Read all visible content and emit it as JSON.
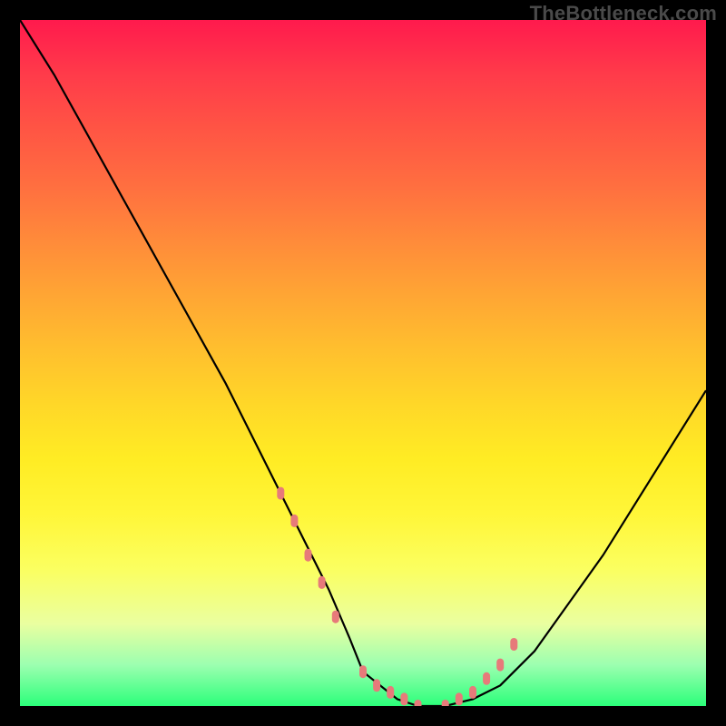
{
  "watermark": "TheBottleneck.com",
  "chart_data": {
    "type": "line",
    "title": "",
    "xlabel": "",
    "ylabel": "",
    "xlim": [
      0,
      100
    ],
    "ylim": [
      0,
      100
    ],
    "series": [
      {
        "name": "bottleneck-curve",
        "x": [
          0,
          5,
          10,
          15,
          20,
          25,
          30,
          35,
          40,
          45,
          48,
          50,
          55,
          58,
          62,
          66,
          70,
          75,
          80,
          85,
          90,
          95,
          100
        ],
        "values": [
          100,
          92,
          83,
          74,
          65,
          56,
          47,
          37,
          27,
          17,
          10,
          5,
          1,
          0,
          0,
          1,
          3,
          8,
          15,
          22,
          30,
          38,
          46
        ]
      }
    ],
    "markers": {
      "name": "highlight-dots",
      "color": "#e77a7a",
      "x": [
        38,
        40,
        42,
        44,
        46,
        50,
        52,
        54,
        56,
        58,
        62,
        64,
        66,
        68,
        70,
        72
      ],
      "values": [
        31,
        27,
        22,
        18,
        13,
        5,
        3,
        2,
        1,
        0,
        0,
        1,
        2,
        4,
        6,
        9
      ]
    }
  }
}
